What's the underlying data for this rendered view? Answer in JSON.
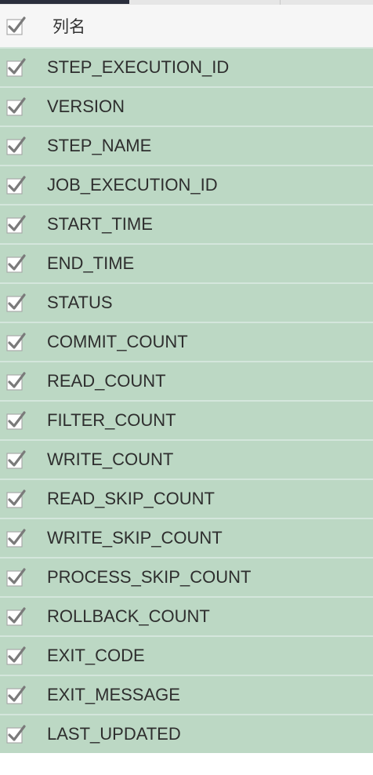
{
  "header": {
    "column_label": "列名",
    "checked": true
  },
  "columns": [
    {
      "name": "STEP_EXECUTION_ID",
      "checked": true
    },
    {
      "name": "VERSION",
      "checked": true
    },
    {
      "name": "STEP_NAME",
      "checked": true
    },
    {
      "name": "JOB_EXECUTION_ID",
      "checked": true
    },
    {
      "name": "START_TIME",
      "checked": true
    },
    {
      "name": "END_TIME",
      "checked": true
    },
    {
      "name": "STATUS",
      "checked": true
    },
    {
      "name": "COMMIT_COUNT",
      "checked": true
    },
    {
      "name": "READ_COUNT",
      "checked": true
    },
    {
      "name": "FILTER_COUNT",
      "checked": true
    },
    {
      "name": "WRITE_COUNT",
      "checked": true
    },
    {
      "name": "READ_SKIP_COUNT",
      "checked": true
    },
    {
      "name": "WRITE_SKIP_COUNT",
      "checked": true
    },
    {
      "name": "PROCESS_SKIP_COUNT",
      "checked": true
    },
    {
      "name": "ROLLBACK_COUNT",
      "checked": true
    },
    {
      "name": "EXIT_CODE",
      "checked": true
    },
    {
      "name": "EXIT_MESSAGE",
      "checked": true
    },
    {
      "name": "LAST_UPDATED",
      "checked": true
    }
  ],
  "colors": {
    "row_background": "#bcd8c4",
    "header_background": "#f6f6f6",
    "active_tab": "#2b2f3d"
  },
  "icons": {
    "checkbox": "checkmark-checkbox-icon"
  }
}
